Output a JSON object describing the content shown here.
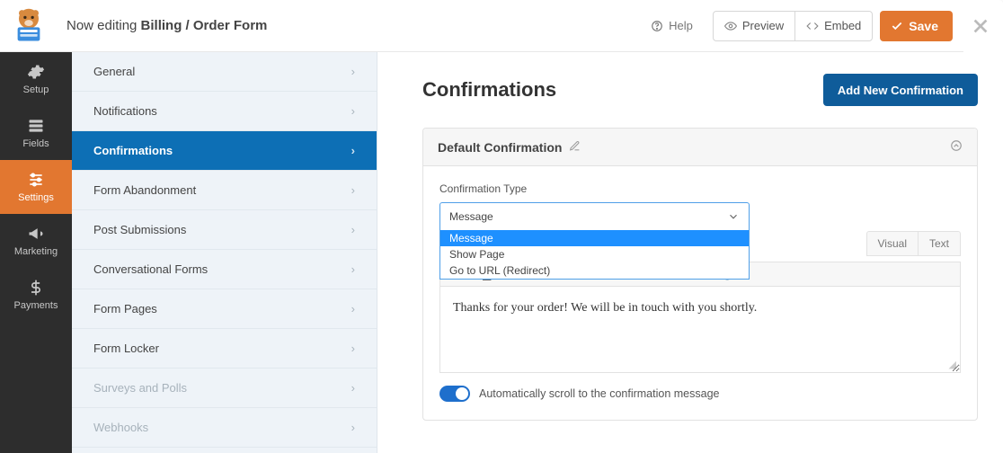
{
  "header": {
    "editing_prefix": "Now editing ",
    "form_name": "Billing / Order Form",
    "help": "Help",
    "preview": "Preview",
    "embed": "Embed",
    "save": "Save"
  },
  "rail": [
    {
      "icon": "gear",
      "label": "Setup"
    },
    {
      "icon": "fields",
      "label": "Fields"
    },
    {
      "icon": "sliders",
      "label": "Settings"
    },
    {
      "icon": "horn",
      "label": "Marketing"
    },
    {
      "icon": "dollar",
      "label": "Payments"
    }
  ],
  "rail_active_index": 2,
  "subnav": [
    {
      "label": "General"
    },
    {
      "label": "Notifications"
    },
    {
      "label": "Confirmations"
    },
    {
      "label": "Form Abandonment"
    },
    {
      "label": "Post Submissions"
    },
    {
      "label": "Conversational Forms"
    },
    {
      "label": "Form Pages"
    },
    {
      "label": "Form Locker"
    },
    {
      "label": "Surveys and Polls",
      "muted": true
    },
    {
      "label": "Webhooks",
      "muted": true
    }
  ],
  "subnav_active_index": 2,
  "main": {
    "title": "Confirmations",
    "add_button": "Add New Confirmation",
    "panel_title": "Default Confirmation",
    "type_label": "Confirmation Type",
    "type_selected": "Message",
    "type_options": [
      "Message",
      "Show Page",
      "Go to URL (Redirect)"
    ],
    "editor_tabs": [
      "Visual",
      "Text"
    ],
    "editor_text": "Thanks for your order! We will be in touch with you shortly.",
    "autoscroll_label": "Automatically scroll to the confirmation message"
  }
}
